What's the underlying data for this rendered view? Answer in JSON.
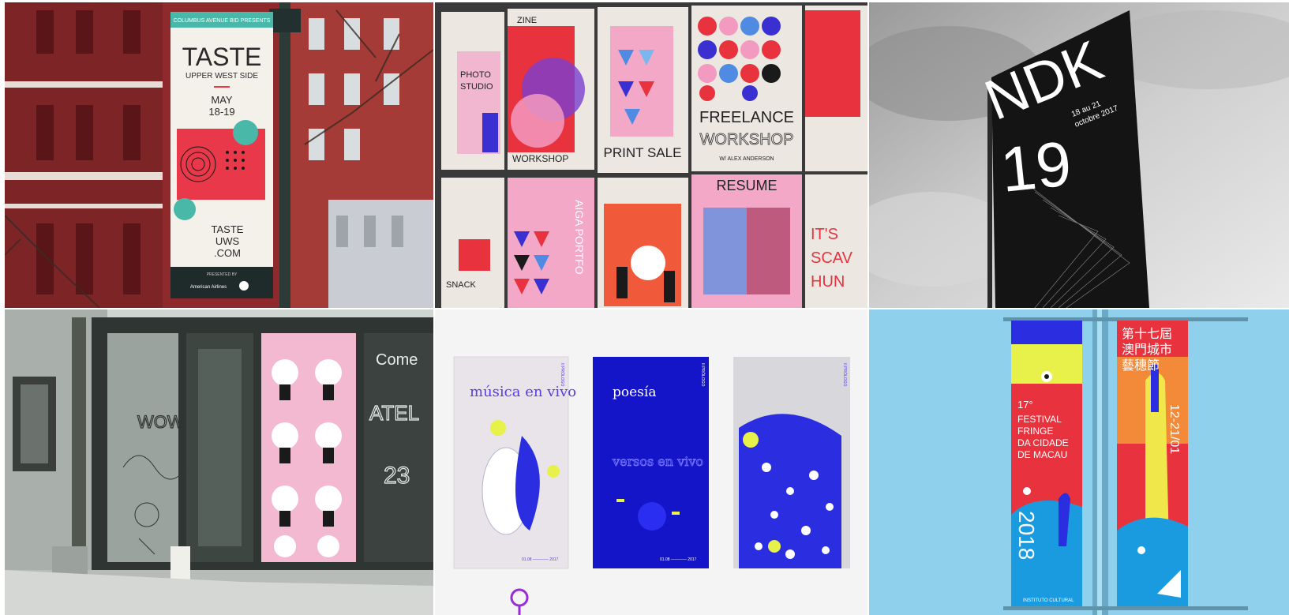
{
  "tiles": {
    "taste": {
      "presents": "COLUMBUS AVENUE BID PRESENTS",
      "title": "TASTE",
      "subtitle": "UPPER WEST SIDE",
      "date_line1": "MAY",
      "date_line2": "18-19",
      "web_line1": "TASTE",
      "web_line2": "UWS",
      "web_line3": ".COM",
      "sponsor_label": "PRESENTED BY",
      "sponsor": "American Airlines"
    },
    "workshop": {
      "zine": "ZINE",
      "photo_line1": "PHOTO",
      "photo_line2": "STUDIO",
      "workshop": "WORKSHOP",
      "print_sale": "PRINT SALE",
      "freelance": "FREELANCE",
      "workshop2": "WORKSHOP",
      "by": "W/ ALEX ANDERSON",
      "resume": "RESUME",
      "aiga": "AIGA PORTFO",
      "snack": "SNACK",
      "scav_line1": "IT'S",
      "scav_line2": "SCAV",
      "scav_line3": "HUN"
    },
    "flag": {
      "letters": "NDK",
      "number": "19",
      "dates_line1": "18 au 21",
      "dates_line2": "octobre 2017"
    },
    "storefront": {
      "glass_text1": "Come",
      "glass_text2": "ATEL",
      "glass_text3": "23",
      "glass_text4": "WOW"
    },
    "poetry": {
      "p1_title": "música en vivo",
      "p2_title": "poesía",
      "p2_sub": "versos en vivo",
      "pdate": "01.08 ———— 2017",
      "p1_side": "II PRÓLOGO",
      "p2_side": "II PRÓLOGO",
      "p3_side": "II PRÓLOGO"
    },
    "fringe": {
      "cn_line1": "第十七屆",
      "cn_line2": "澳門城市",
      "cn_line3": "藝穗節",
      "edition": "17°",
      "en_line1": "FESTIVAL",
      "en_line2": "FRINGE",
      "en_line3": "DA CIDADE",
      "en_line4": "DE MACAU",
      "year": "2018",
      "dates": "12-21/01",
      "footer": "INSTITUTO CULTURAL"
    }
  },
  "colors": {
    "brick": "#8e2a2c",
    "sky_blue": "#8fd0ec",
    "poetry_blue": "#1a1ed0",
    "accent_purple": "#9b2bd3",
    "taste_teal": "#4ab8a8",
    "taste_red": "#e8384a"
  },
  "icons": {
    "cursor": "location-pin-icon"
  }
}
